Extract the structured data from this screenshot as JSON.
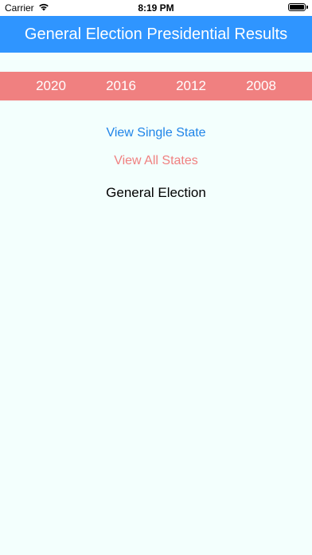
{
  "status_bar": {
    "carrier": "Carrier",
    "time": "8:19 PM"
  },
  "header": {
    "title": "General Election Presidential Results"
  },
  "year_tabs": [
    {
      "label": "2020"
    },
    {
      "label": "2016"
    },
    {
      "label": "2012"
    },
    {
      "label": "2008"
    }
  ],
  "actions": {
    "view_single_state": "View Single State",
    "view_all_states": "View All States"
  },
  "section": {
    "label": "General Election"
  },
  "colors": {
    "nav_background": "#2f95ff",
    "year_bar_background": "#f08080",
    "single_state_link": "#1f84e8",
    "all_states_link": "#f08080",
    "page_background": "#f3fffd"
  }
}
